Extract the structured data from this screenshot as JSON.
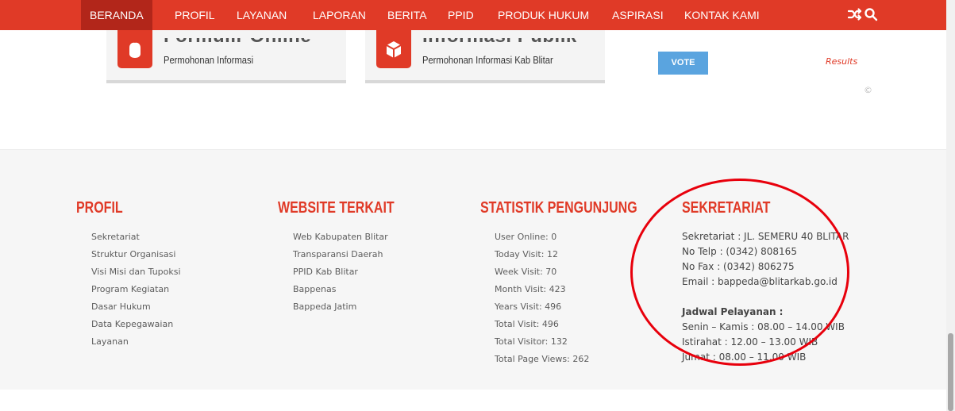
{
  "nav": {
    "items": [
      "BERANDA",
      "PROFIL",
      "LAYANAN",
      "LAPORAN",
      "BERITA",
      "PPID",
      "PRODUK HUKUM",
      "ASPIRASI",
      "KONTAK KAMI"
    ],
    "icons": [
      "shuffle-icon",
      "search-icon"
    ]
  },
  "cards": [
    {
      "title": "Formulir Online",
      "subtitle": "Permohonan Informasi",
      "icon": "apple-icon"
    },
    {
      "title": "Informasi Publik",
      "subtitle": "Permohonan Informasi Kab Blitar",
      "icon": "cube-icon"
    }
  ],
  "poll": {
    "vote_label": "VOTE",
    "results_label": "Results",
    "copyright": "©"
  },
  "footer": {
    "profil": {
      "title": "PROFIL",
      "items": [
        "Sekretariat",
        "Struktur Organisasi",
        "Visi Misi dan Tupoksi",
        "Program Kegiatan",
        "Dasar Hukum",
        "Data Kepegawaian",
        "Layanan"
      ]
    },
    "website": {
      "title": "WEBSITE TERKAIT",
      "items": [
        "Web Kabupaten Blitar",
        "Transparansi Daerah",
        "PPID Kab Blitar",
        "Bappenas",
        "Bappeda Jatim"
      ]
    },
    "statistik": {
      "title": "STATISTIK PENGUNJUNG",
      "items": [
        "User Online: 0",
        "Today Visit: 12",
        "Week Visit: 70",
        "Month Visit: 423",
        "Years Visit: 496",
        "Total Visit: 496",
        "Total Visitor: 132",
        "Total Page Views: 262"
      ]
    },
    "sekretariat": {
      "title": "SEKRETARIAT",
      "address": "Sekretariat : JL. SEMERU 40 BLITAR",
      "telp": "No Telp : (0342) 808165",
      "fax": "No Fax : (0342) 806275",
      "email": "Email : bappeda@blitarkab.go.id",
      "jadwal_title": "Jadwal Pelayanan :",
      "jadwal": [
        "Senin – Kamis : 08.00 – 14.00 WIB",
        "Istirahat : 12.00 – 13.00 WIB",
        "Jumat : 08.00 – 11.00 WIB"
      ]
    }
  },
  "colors": {
    "brand": "#e03a27",
    "nav_active": "#b2261a",
    "vote": "#5aa4df",
    "annotation": "#e8000c"
  }
}
